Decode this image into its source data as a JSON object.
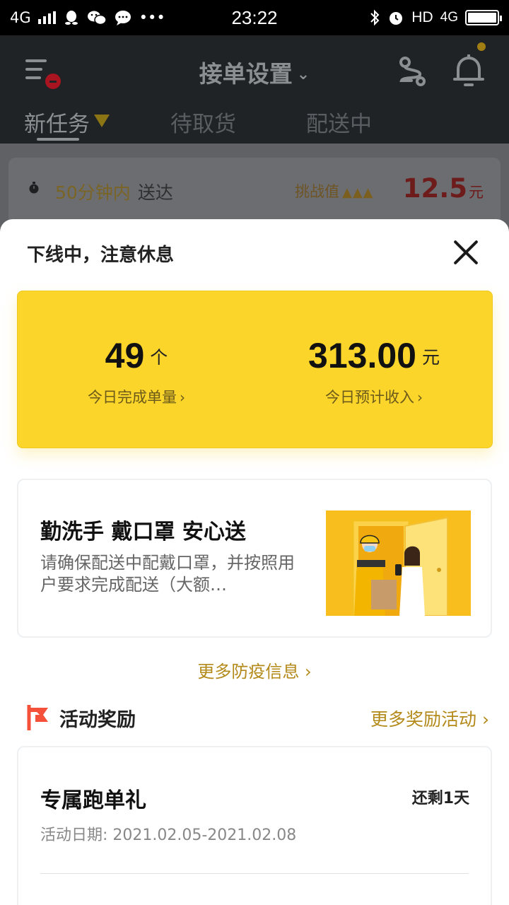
{
  "status_bar": {
    "network": "4G",
    "time": "23:22",
    "hd": "HD",
    "net_right": "4G",
    "dots": "•••"
  },
  "header": {
    "title": "接单设置",
    "tabs": [
      {
        "label": "新任务"
      },
      {
        "label": "待取货"
      },
      {
        "label": "配送中"
      }
    ]
  },
  "task": {
    "time_text": "50分钟内",
    "deliver_text": "送达",
    "challenge_label": "挑战值",
    "price": "12.5",
    "price_unit": "元"
  },
  "sheet": {
    "title": "下线中，注意休息",
    "stats": [
      {
        "value": "49",
        "unit": "个",
        "label": "今日完成单量"
      },
      {
        "value": "313.00",
        "unit": "元",
        "label": "今日预计收入"
      }
    ],
    "covid": {
      "title": "勤洗手 戴口罩 安心送",
      "desc": "请确保配送中配戴口罩，并按照用户要求完成配送（大额…"
    },
    "more_covid": "更多防疫信息",
    "rewards": {
      "title": "活动奖励",
      "more": "更多奖励活动",
      "card": {
        "title": "专属跑单礼",
        "remaining": "还剩1天",
        "date": "活动日期: 2021.02.05-2021.02.08"
      }
    }
  },
  "colors": {
    "accent_yellow": "#fcd52a",
    "gold_text": "#b38a1a",
    "flag_red": "#f4503a"
  }
}
